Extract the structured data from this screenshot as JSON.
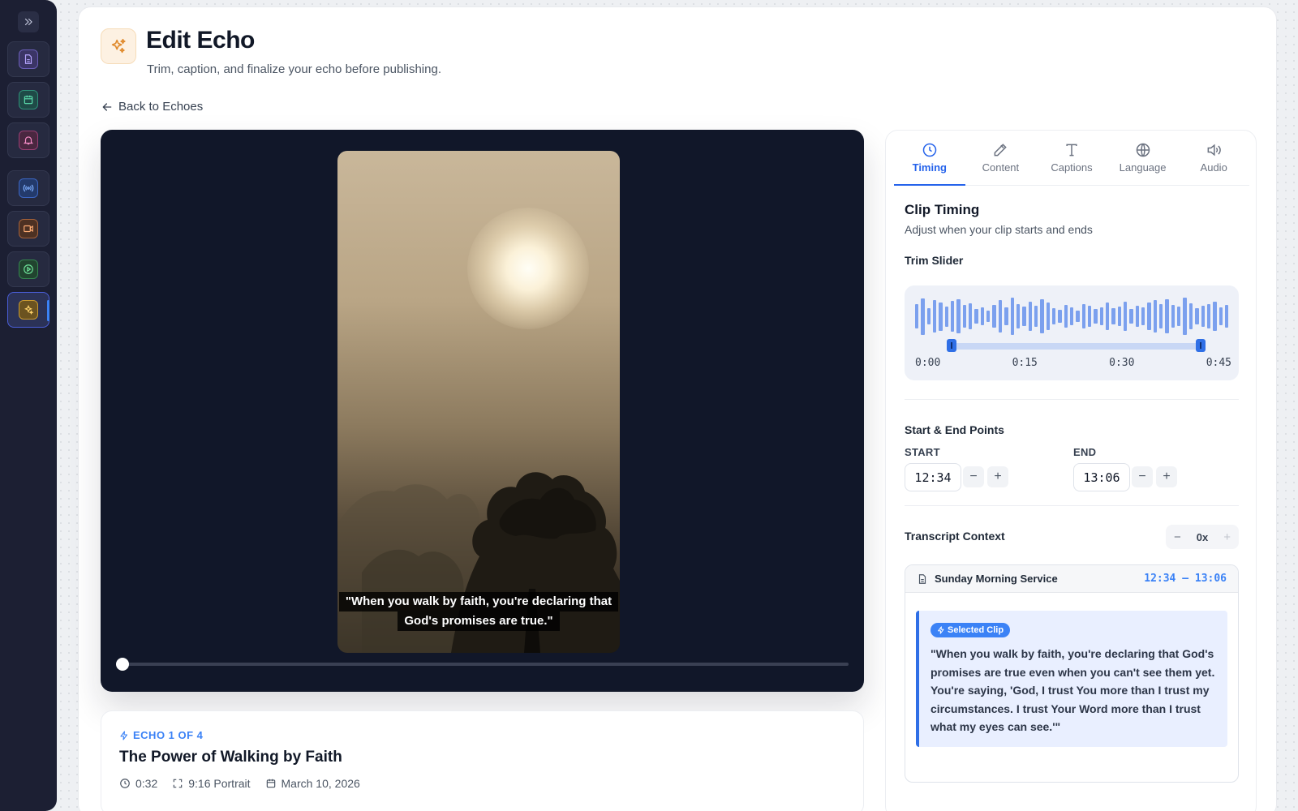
{
  "colors": {
    "accent": "#2563eb",
    "sidebar_bg": "#1c1f33",
    "video_bg": "#111729",
    "clip_bg": "#e9efff"
  },
  "sidebar": {
    "toggle_icon": "chevrons-right-icon",
    "items": [
      {
        "icon": "document-icon",
        "color": "#a78bfa"
      },
      {
        "icon": "calendar-icon",
        "color": "#34d399"
      },
      {
        "icon": "bell-icon",
        "color": "#f472b6"
      },
      {
        "icon": "broadcast-icon",
        "color": "#60a5fa"
      },
      {
        "icon": "video-icon",
        "color": "#fb923c"
      },
      {
        "icon": "play-circle-icon",
        "color": "#4ade80"
      },
      {
        "icon": "sparkles-icon",
        "color": "#fbbf24",
        "active": true
      }
    ]
  },
  "header": {
    "icon": "sparkles-icon",
    "title": "Edit Echo",
    "subtitle": "Trim, caption, and finalize your echo before publishing.",
    "back_label": "Back to Echoes"
  },
  "video": {
    "caption_line1": "\"When you walk by faith, you're declaring that",
    "caption_line2": "God's promises are true.\"",
    "progress": 0
  },
  "echo_info": {
    "eyebrow": "ECHO 1 OF 4",
    "title": "The Power of Walking by Faith",
    "duration": "0:32",
    "format": "9:16 Portrait",
    "date": "March 10, 2026"
  },
  "tabs": [
    {
      "label": "Timing",
      "icon": "clock-icon",
      "active": true
    },
    {
      "label": "Content",
      "icon": "edit-icon"
    },
    {
      "label": "Captions",
      "icon": "text-icon"
    },
    {
      "label": "Language",
      "icon": "globe-icon"
    },
    {
      "label": "Audio",
      "icon": "speaker-icon"
    }
  ],
  "timing": {
    "title": "Clip Timing",
    "subtitle": "Adjust when your clip starts and ends",
    "trim_label": "Trim Slider",
    "ticks": [
      "0:00",
      "0:15",
      "0:30",
      "0:45"
    ],
    "waveform": [
      30,
      45,
      20,
      40,
      35,
      25,
      38,
      42,
      28,
      32,
      18,
      22,
      14,
      28,
      40,
      22,
      46,
      30,
      24,
      36,
      26,
      42,
      34,
      20,
      16,
      28,
      22,
      14,
      30,
      26,
      18,
      22,
      34,
      20,
      24,
      36,
      18,
      26,
      22,
      34,
      40,
      30,
      42,
      28,
      24,
      46,
      32,
      20,
      26,
      30,
      36,
      22,
      28
    ],
    "trim_start": 0.1,
    "trim_end": 0.9,
    "points_title": "Start & End Points",
    "start_label": "START",
    "start_value": "12:34",
    "end_label": "END",
    "end_value": "13:06",
    "minus": "−",
    "plus": "+"
  },
  "transcript": {
    "title": "Transcript Context",
    "zoom": "0x",
    "source": "Sunday Morning Service",
    "range": "12:34 – 13:06",
    "badge": "Selected Clip",
    "text": "\"When you walk by faith, you're declaring that God's promises are true even when you can't see them yet. You're saying, 'God, I trust You more than I trust my circumstances. I trust Your Word more than I trust what my eyes can see.'\""
  }
}
